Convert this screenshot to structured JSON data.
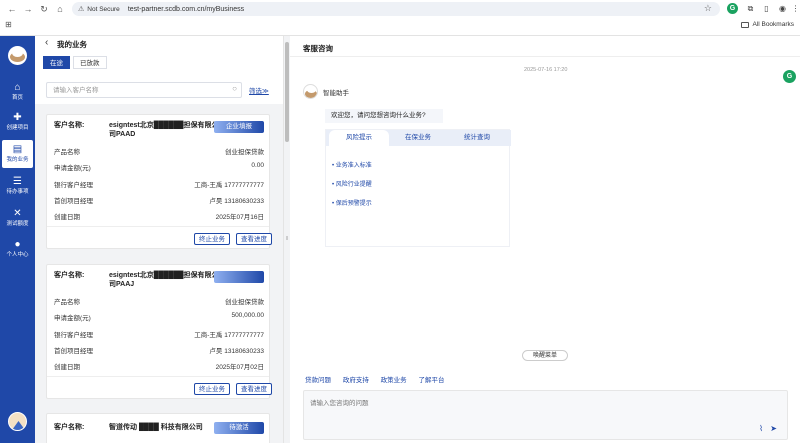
{
  "browser": {
    "security_label": "Not Secure",
    "url": "test-partner.scdb.com.cn/myBusiness",
    "bookmarks_label": "All Bookmarks"
  },
  "sidenav": {
    "items": [
      {
        "label": "首页",
        "icon": "home-icon"
      },
      {
        "label": "创建项目",
        "icon": "create-project-icon"
      },
      {
        "label": "我的业务",
        "icon": "my-business-icon",
        "active": true
      },
      {
        "label": "待办事项",
        "icon": "todo-icon"
      },
      {
        "label": "测试额度",
        "icon": "tools-icon"
      },
      {
        "label": "个人中心",
        "icon": "user-icon"
      }
    ]
  },
  "panel": {
    "title": "我的业务",
    "tabs": [
      "在途",
      "已放款"
    ],
    "search_placeholder": "请输入客户名称",
    "filter_label": "筛选",
    "customer_label": "客户名称:",
    "cards": [
      {
        "name": "esigntest北京██████担保有限公司PAAD",
        "badge": "企业填报",
        "rows": [
          {
            "k": "产品名称",
            "v": "创业担保贷款"
          },
          {
            "k": "申请金额(元)",
            "v": "0.00"
          },
          {
            "k": "银行客户经理",
            "v": "工商-王禹 17777777777"
          },
          {
            "k": "首创项目经理",
            "v": "卢昊 13180630233"
          },
          {
            "k": "创建日期",
            "v": "2025年07月16日"
          }
        ],
        "buttons": [
          "终止业务",
          "查看进度"
        ]
      },
      {
        "name": "esigntest北京██████担保有限公司PAAJ",
        "badge": "",
        "rows": [
          {
            "k": "产品名称",
            "v": "创业担保贷款"
          },
          {
            "k": "申请金额(元)",
            "v": "500,000.00"
          },
          {
            "k": "银行客户经理",
            "v": "工商-王禹 17777777777"
          },
          {
            "k": "首创项目经理",
            "v": "卢昊 13180630233"
          },
          {
            "k": "创建日期",
            "v": "2025年07月02日"
          }
        ],
        "buttons": [
          "终止业务",
          "查看进度"
        ]
      },
      {
        "name": "智道传动 ████ 科技有限公司",
        "badge": "待激活",
        "rows": [],
        "buttons": []
      }
    ]
  },
  "chat": {
    "title": "客服咨询",
    "timestamp": "2025-07-16 17:20",
    "bot_name": "智能助手",
    "welcome": "欢迎您，请问您想咨询什么业务?",
    "topic_tabs": [
      "风险提示",
      "在保业务",
      "统计查询"
    ],
    "topic_items": [
      "业务准入标准",
      "风险行业提醒",
      "保后预警提示"
    ],
    "wake_menu": "唤醒菜单",
    "quick_links": [
      "贷款问题",
      "政府支持",
      "政策业务",
      "了解平台"
    ],
    "input_placeholder": "请输入您咨询的问题"
  }
}
